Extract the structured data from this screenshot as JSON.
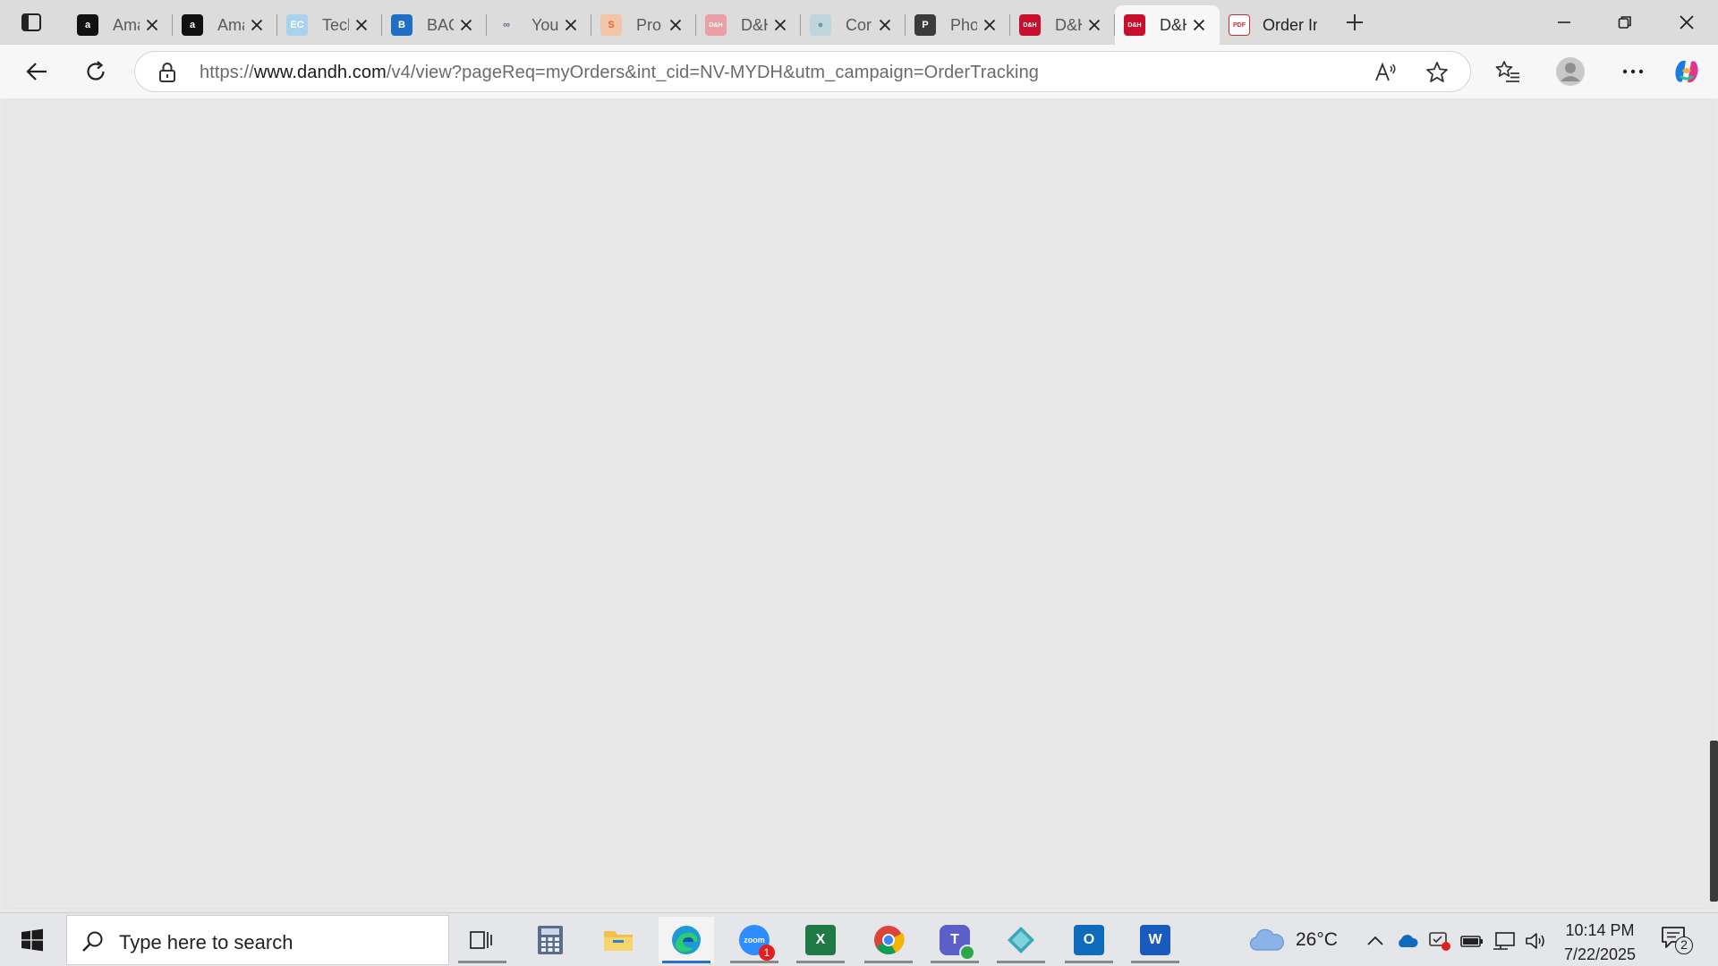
{
  "browser": {
    "tabs": [
      {
        "title": "Amazon",
        "favicon": "amazon-icon",
        "fav_bg": "#111111",
        "fav_fg": "#ffffff",
        "fav_char": "a"
      },
      {
        "title": "Amazon",
        "favicon": "amazon-icon",
        "fav_bg": "#111111",
        "fav_fg": "#ffffff",
        "fav_char": "a"
      },
      {
        "title": "Tech",
        "favicon": "ec-icon",
        "fav_bg": "#a9d3ec",
        "fav_fg": "#ffffff",
        "fav_char": "EC"
      },
      {
        "title": "BAC",
        "favicon": "bac-icon",
        "fav_bg": "#1f6fc4",
        "fav_fg": "#ffffff",
        "fav_char": "B"
      },
      {
        "title": "Your",
        "favicon": "link-rings-icon",
        "fav_bg": "#dcdcdc",
        "fav_fg": "#7a5a8a",
        "fav_char": "∞"
      },
      {
        "title": "Pro",
        "favicon": "swirl-icon",
        "fav_bg": "#f2c4a8",
        "fav_fg": "#e06a3a",
        "fav_char": "S"
      },
      {
        "title": "D&H",
        "favicon": "dandh-icon",
        "fav_bg": "#e8a0a6",
        "fav_fg": "#ffffff",
        "fav_char": "D&H"
      },
      {
        "title": "Cor",
        "favicon": "globe-icon",
        "fav_bg": "#bcd6dc",
        "fav_fg": "#6a9aa6",
        "fav_char": "●"
      },
      {
        "title": "Pho",
        "favicon": "page-icon",
        "fav_bg": "#3b3b3b",
        "fav_fg": "#ffffff",
        "fav_char": "P"
      },
      {
        "title": "D&H",
        "favicon": "dandh-icon",
        "fav_bg": "#c8102e",
        "fav_fg": "#ffffff",
        "fav_char": "D&H"
      },
      {
        "title": "D&H",
        "favicon": "dandh-icon",
        "fav_bg": "#c8102e",
        "fav_fg": "#ffffff",
        "fav_char": "D&H"
      },
      {
        "title": "Order In",
        "favicon": "pdf-icon",
        "fav_bg": "#ffffff",
        "fav_fg": "#d12a2a",
        "fav_char": "PDF"
      }
    ],
    "active_tab_index": 10,
    "address": {
      "scheme": "https://",
      "host": "www.dandh.com",
      "path": "/v4/view?pageReq=myOrders&int_cid=NV-MYDH&utm_campaign=OrderTracking"
    }
  },
  "taskbar": {
    "search_placeholder": "Type here to search",
    "apps": [
      {
        "name": "task-view-icon",
        "tile_bg": "transparent",
        "label": ""
      },
      {
        "name": "calculator-icon",
        "tile_bg": "#5a6d8c",
        "label": ""
      },
      {
        "name": "file-explorer-icon",
        "tile_bg": "#f0c24b",
        "label": ""
      },
      {
        "name": "edge-icon",
        "tile_bg": "#1c9ad6",
        "label": ""
      },
      {
        "name": "zoom-icon",
        "tile_bg": "#2d8cff",
        "label": "zoom",
        "badge": "1"
      },
      {
        "name": "excel-icon",
        "tile_bg": "#1f7a45",
        "label": "X"
      },
      {
        "name": "chrome-icon",
        "tile_bg": "#ffffff",
        "label": ""
      },
      {
        "name": "teams-icon",
        "tile_bg": "#5b5fc7",
        "label": "T"
      },
      {
        "name": "diamond-app-icon",
        "tile_bg": "#3aa8b8",
        "label": ""
      },
      {
        "name": "outlook-icon",
        "tile_bg": "#0f6cbd",
        "label": "O"
      },
      {
        "name": "word-icon",
        "tile_bg": "#185abd",
        "label": "W"
      }
    ],
    "weather": {
      "temp": "26°C",
      "icon": "cloud-icon"
    },
    "clock": {
      "time": "10:14 PM",
      "date": "7/22/2025"
    },
    "notification_count": "2"
  }
}
